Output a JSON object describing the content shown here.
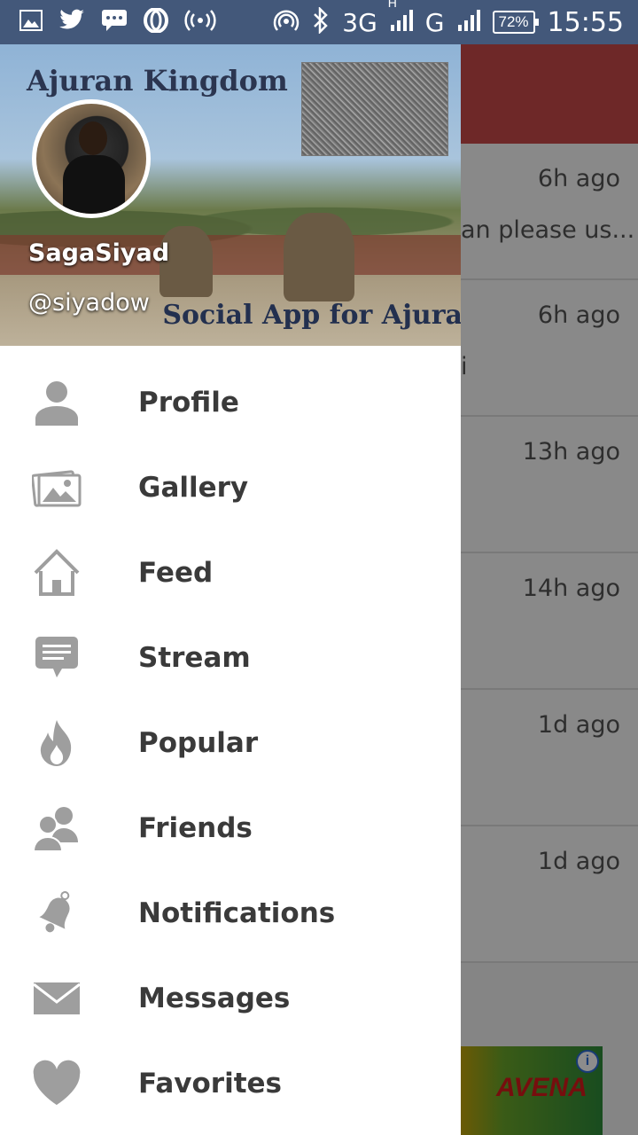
{
  "status_bar": {
    "network_3g": "3G",
    "network_h": "H",
    "network_g": "G",
    "battery": "72%",
    "time": "15:55"
  },
  "drawer": {
    "header": {
      "title": "Ajuran Kingdom",
      "subtitle": "Social App for Ajura",
      "username": "SagaSiyad",
      "handle": "@siyadow"
    },
    "menu": [
      {
        "label": "Profile",
        "icon": "person-icon"
      },
      {
        "label": "Gallery",
        "icon": "gallery-icon"
      },
      {
        "label": "Feed",
        "icon": "home-icon"
      },
      {
        "label": "Stream",
        "icon": "chat-icon"
      },
      {
        "label": "Popular",
        "icon": "flame-icon"
      },
      {
        "label": "Friends",
        "icon": "friends-icon"
      },
      {
        "label": "Notifications",
        "icon": "bell-icon"
      },
      {
        "label": "Messages",
        "icon": "mail-icon"
      },
      {
        "label": "Favorites",
        "icon": "heart-icon"
      }
    ]
  },
  "background_feed": {
    "items": [
      {
        "time": "6h ago",
        "snippet": "an please us..."
      },
      {
        "time": "6h ago",
        "snippet": "i"
      },
      {
        "time": "13h ago",
        "snippet": ""
      },
      {
        "time": "14h ago",
        "snippet": ""
      },
      {
        "time": "1d ago",
        "snippet": ""
      },
      {
        "time": "1d ago",
        "snippet": ""
      }
    ],
    "ad_text": "AVENA"
  },
  "colors": {
    "status_bar": "#43587a",
    "toolbar": "#c94a4a",
    "icon_gray": "#9e9e9e"
  }
}
